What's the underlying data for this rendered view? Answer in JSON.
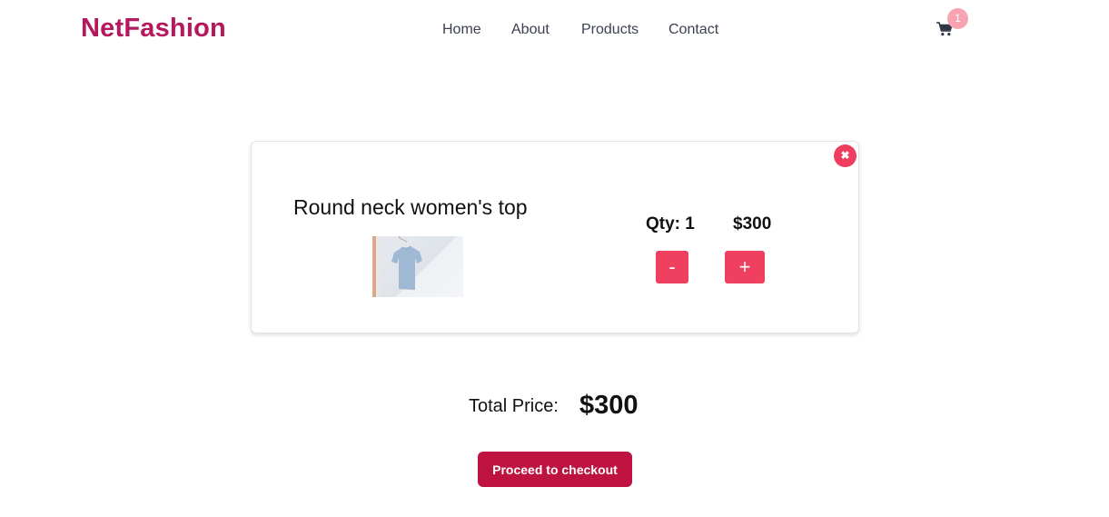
{
  "header": {
    "brand": "NetFashion",
    "nav": [
      {
        "label": "Home"
      },
      {
        "label": "About"
      },
      {
        "label": "Products"
      },
      {
        "label": "Contact"
      }
    ],
    "cart": {
      "icon": "cart-icon",
      "count": "1"
    }
  },
  "cart_items": [
    {
      "name": "Round neck women's top",
      "image_alt": "Light blue t-shirt on hanger",
      "quantity_label": "Qty: 1",
      "quantity": 1,
      "price": "$300",
      "decrement_label": "-",
      "increment_label": "+",
      "remove_icon": "close-icon"
    }
  ],
  "summary": {
    "total_label": "Total Price:",
    "total_value": "$300",
    "checkout_label": "Proceed to checkout"
  },
  "colors": {
    "brand": "#b5185e",
    "accent": "#f0405f",
    "checkout": "#be1340",
    "badge": "#f7a3b2"
  }
}
